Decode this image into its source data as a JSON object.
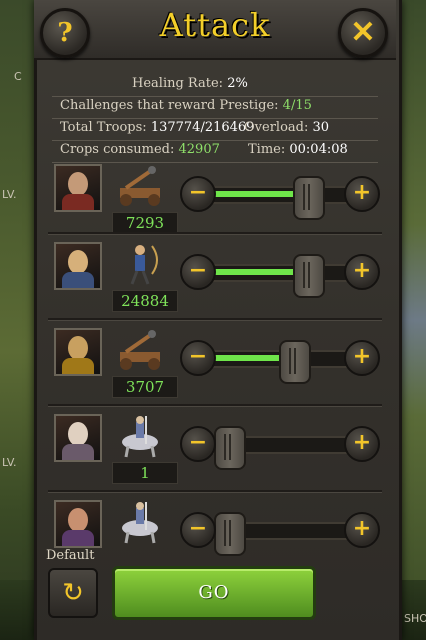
{
  "dialog": {
    "title": "Attack",
    "help_label": "?",
    "close_label": "✕"
  },
  "stats": {
    "healing_rate_label": "Healing Rate:",
    "healing_rate_value": "2%",
    "challenges_label": "Challenges that reward Prestige:",
    "challenges_value": "4/15",
    "total_troops_label": "Total Troops:",
    "total_troops_value": "137774/216469",
    "overload_label": "Overload:",
    "overload_value": "30",
    "crops_label": "Crops consumed:",
    "crops_value": "42907",
    "time_label": "Time:",
    "time_value": "00:04:08"
  },
  "rows": [
    {
      "hero": "hero-portrait-1",
      "unit": "catapult-icon",
      "count": "7293",
      "fill": 0.73
    },
    {
      "hero": "hero-portrait-2",
      "unit": "archer-icon",
      "count": "24884",
      "fill": 0.73
    },
    {
      "hero": "hero-portrait-3",
      "unit": "catapult-icon",
      "count": "3707",
      "fill": 0.6
    },
    {
      "hero": "hero-portrait-4",
      "unit": "cavalry-icon",
      "count": "1",
      "fill": 0.0
    },
    {
      "hero": "hero-portrait-5",
      "unit": "cavalry-icon",
      "count": "",
      "fill": 0.0
    }
  ],
  "controls": {
    "minus_label": "−",
    "plus_label": "+"
  },
  "footer": {
    "default_label": "Default",
    "default_icon": "↻",
    "go_label": "GO"
  },
  "edges": {
    "left_c": "C",
    "left_lv1": "LV.",
    "left_lv2": "LV.",
    "right_sho": "SHO"
  },
  "colors": {
    "title": "#f3cf2a",
    "count": "#7fe35a",
    "slider_fill": "#6fe54a",
    "go_button": "#6fb02e"
  }
}
